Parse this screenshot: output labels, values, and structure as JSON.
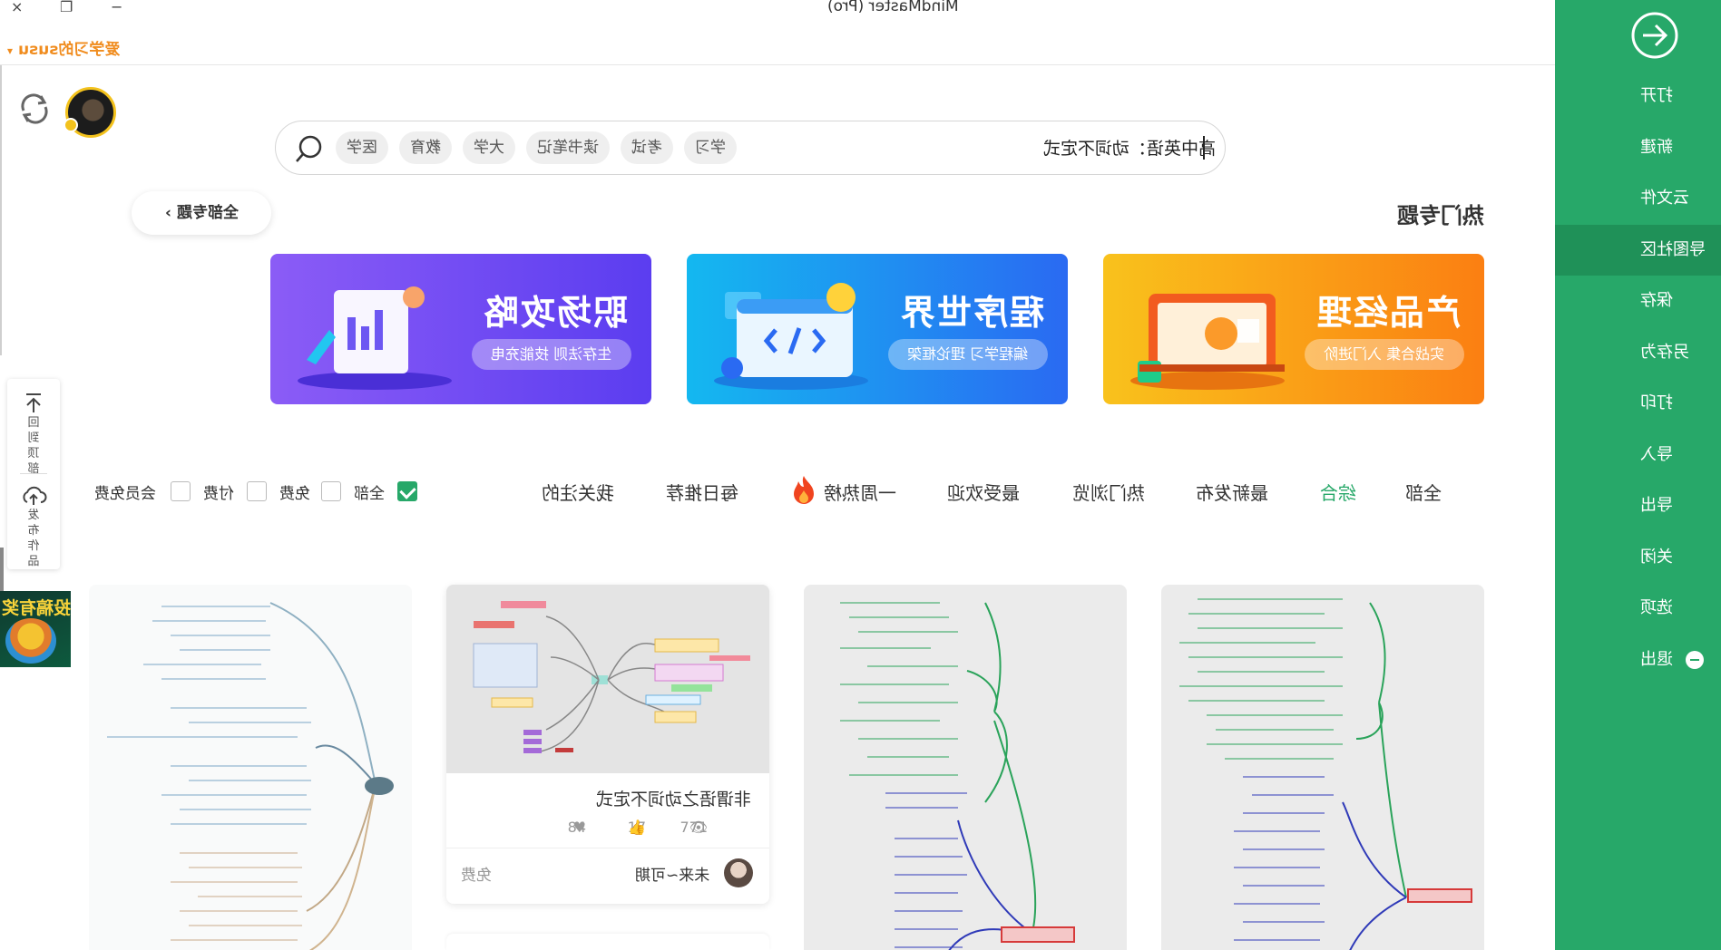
{
  "window": {
    "title": "MindMaster (Pro)",
    "controls": {
      "minimize": "−",
      "restore": "❐",
      "close": "×"
    }
  },
  "user": {
    "name": "爱学习的susu"
  },
  "sidebar": {
    "items": [
      {
        "label": "打开"
      },
      {
        "label": "新建"
      },
      {
        "label": "云文件"
      },
      {
        "label": "导图社区",
        "active": true
      },
      {
        "label": "保存"
      },
      {
        "label": "另存为"
      },
      {
        "label": "打印"
      },
      {
        "label": "导入"
      },
      {
        "label": "导出"
      },
      {
        "label": "关闭"
      },
      {
        "label": "选项"
      },
      {
        "label": "退出"
      }
    ],
    "color": "#27a869"
  },
  "left_tools": {
    "back_to_top": "回到顶部",
    "publish": "发布作品",
    "promo_text": "投稿有奖"
  },
  "search": {
    "query": "高中英语：动词不定式",
    "tags": [
      "学习",
      "考试",
      "读书笔记",
      "大学",
      "教育",
      "医学"
    ]
  },
  "hot": {
    "title": "热门专题",
    "all_topics": "全部专题"
  },
  "banners": [
    {
      "title": "职场攻略",
      "subtitle": "生存法则 技能充电",
      "color": "#7b4ff3"
    },
    {
      "title": "程序世界",
      "subtitle": "编程学习 理论框架",
      "color": "#1f8ff2"
    },
    {
      "title": "产品经理",
      "subtitle": "实战合集 入门进阶",
      "color": "#fba117"
    }
  ],
  "tabs": [
    {
      "label": "全部"
    },
    {
      "label": "综合",
      "active": true
    },
    {
      "label": "最新发布"
    },
    {
      "label": "热门浏览"
    },
    {
      "label": "最受欢迎"
    },
    {
      "label": "一周热榜"
    },
    {
      "label": "每日推荐"
    },
    {
      "label": "我关注的"
    }
  ],
  "price_filters": [
    {
      "label": "全部",
      "checked": true
    },
    {
      "label": "免费",
      "checked": false
    },
    {
      "label": "付费",
      "checked": false
    },
    {
      "label": "会员免费",
      "checked": false
    }
  ],
  "cards": [
    {
      "title": "",
      "kind": "mindmap-green"
    },
    {
      "title": "",
      "kind": "mindmap-green-red"
    },
    {
      "title": "非谓语之动词不定式",
      "views": "771",
      "likes": "17",
      "favorites": "84",
      "author": "未来~可期",
      "price": "免费",
      "kind": "mindmap-colorful"
    },
    {
      "title": "",
      "kind": "mindmap-blue"
    }
  ]
}
